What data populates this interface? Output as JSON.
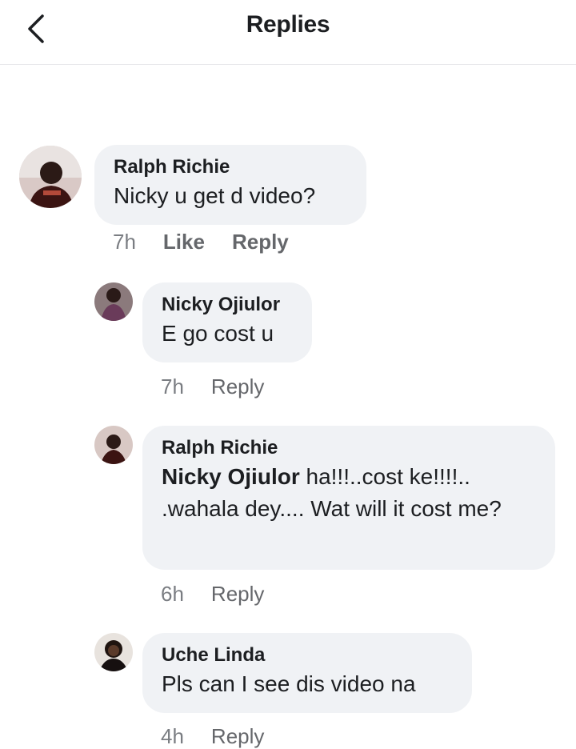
{
  "header": {
    "title": "Replies"
  },
  "comments": [
    {
      "author": "Ralph Richie",
      "text": "Nicky u get d video?",
      "time": "7h",
      "like": "Like",
      "reply": "Reply"
    },
    {
      "author": "Nicky Ojiulor",
      "text": "E go cost u",
      "time": "7h",
      "reply": "Reply"
    },
    {
      "author": "Ralph Richie",
      "mention": "Nicky Ojiulor",
      "text": " ha!!!..cost ke!!!!.. .wahala dey.... Wat will it cost me?",
      "time": "6h",
      "reply": "Reply"
    },
    {
      "author": "Uche Linda",
      "text": "Pls can I see dis video na",
      "time": "4h",
      "reply": "Reply"
    }
  ],
  "icons": {
    "back": "chevron-left-icon"
  },
  "colors": {
    "bubble": "#f0f2f5",
    "meta": "#65676b"
  }
}
